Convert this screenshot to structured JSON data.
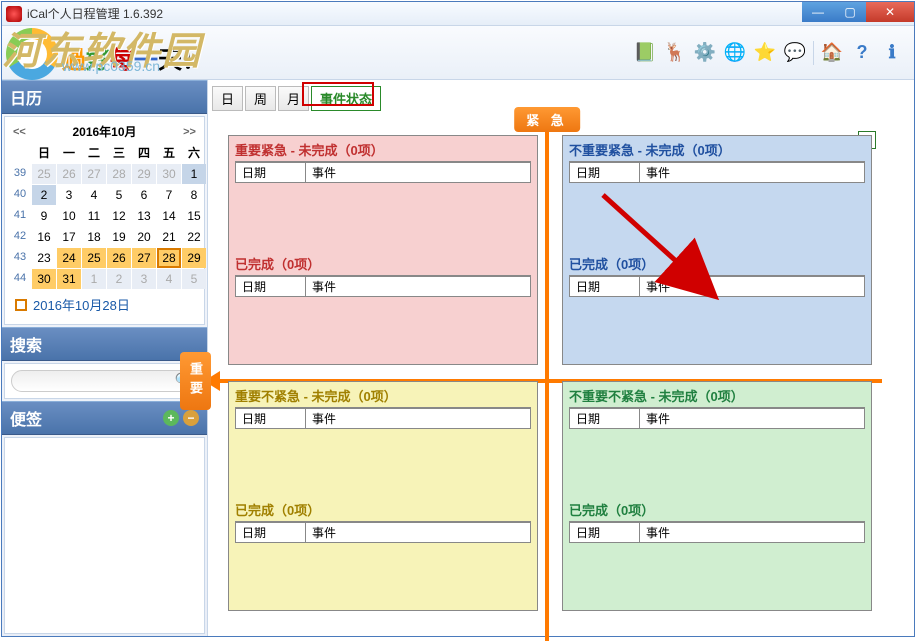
{
  "window": {
    "title": "iCal个人日程管理    1.6.392"
  },
  "watermark": {
    "main": "河东软件园",
    "sub": "www.pc0359.cn",
    "happy": "過好每一天！"
  },
  "toolbar_icons": [
    "book",
    "animal",
    "gear",
    "globe",
    "star",
    "chat",
    "home",
    "help",
    "info"
  ],
  "sidebar": {
    "calendar": {
      "title": "日历",
      "month_label": "2016年10月",
      "dow": [
        "日",
        "一",
        "二",
        "三",
        "四",
        "五",
        "六"
      ],
      "weeks": [
        39,
        40,
        41,
        42,
        43,
        44
      ],
      "days": [
        [
          25,
          26,
          27,
          28,
          29,
          30,
          1
        ],
        [
          2,
          3,
          4,
          5,
          6,
          7,
          8
        ],
        [
          9,
          10,
          11,
          12,
          13,
          14,
          15
        ],
        [
          16,
          17,
          18,
          19,
          20,
          21,
          22
        ],
        [
          23,
          24,
          25,
          26,
          27,
          28,
          29
        ],
        [
          30,
          31,
          1,
          2,
          3,
          4,
          5
        ]
      ],
      "selected_date": "2016年10月28日"
    },
    "search": {
      "title": "搜索",
      "placeholder": ""
    },
    "notes": {
      "title": "便签"
    }
  },
  "tabs": {
    "day": "日",
    "week": "周",
    "month": "月",
    "status": "事件状态"
  },
  "matrix": {
    "urgent_label": "紧 急",
    "important_label": "重要",
    "col_date": "日期",
    "col_event": "事件",
    "q1": {
      "pending": "重要紧急 - 未完成（0项）",
      "done": "已完成（0项）"
    },
    "q2": {
      "pending": "不重要紧急 - 未完成（0项）",
      "done": "已完成（0项）"
    },
    "q3": {
      "pending": "重要不紧急 - 未完成（0项）",
      "done": "已完成（0项）"
    },
    "q4": {
      "pending": "不重要不紧急 - 未完成（0项）",
      "done": "已完成（0项）"
    },
    "excel": "X"
  }
}
